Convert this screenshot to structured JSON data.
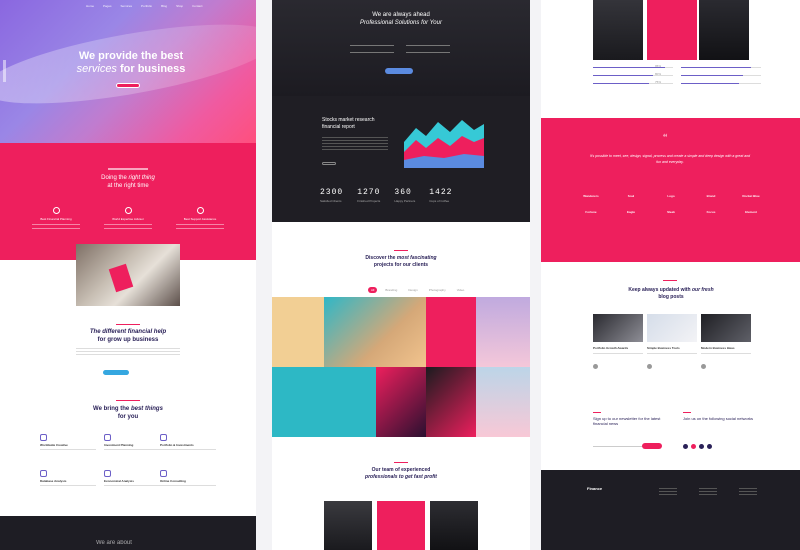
{
  "col1": {
    "hero": {
      "logo": "",
      "nav": [
        "Home",
        "Pages",
        "Services",
        "Portfolio",
        "Blog",
        "Shop",
        "Contact"
      ],
      "title_a": "We provide the best",
      "title_em": "services",
      "title_b": " for business"
    },
    "pink": {
      "title_a": "Doing the",
      "title_em": "right thing",
      "title_b": "at the right time",
      "features": [
        {
          "label": "Best Financial Planning",
          "icon": "chart-icon"
        },
        {
          "label": "World Expertise Advisor",
          "icon": "globe-icon"
        },
        {
          "label": "Best Support Assistance",
          "icon": "support-icon"
        }
      ]
    },
    "about": {
      "title_em": "The different financial help",
      "title_b": "for grow up business"
    },
    "services": {
      "title_a": "We bring the",
      "title_em": "best things",
      "title_b": "for you",
      "items": [
        {
          "label": "Worldwide Creative",
          "icon": "globe-icon"
        },
        {
          "label": "Investment Planning",
          "icon": "plan-icon"
        },
        {
          "label": "Portfolio & Investments",
          "icon": "briefcase-icon"
        },
        {
          "label": "Database Analysis",
          "icon": "database-icon"
        },
        {
          "label": "Economical Analysis",
          "icon": "analysis-icon"
        },
        {
          "label": "Online Consulting",
          "icon": "rocket-icon"
        }
      ]
    },
    "footer_text": "We are about"
  },
  "col2": {
    "hero": {
      "title_a": "We are always ahead",
      "title_em": "Professional Solutions for Your"
    },
    "report": {
      "title": "Stocks market research financial report"
    },
    "stats": [
      {
        "n": "2300",
        "l": "Satisfied Clients"
      },
      {
        "n": "1270",
        "l": "Finished Projects"
      },
      {
        "n": "360",
        "l": "Happy Partners"
      },
      {
        "n": "1422",
        "l": "Cups of Coffee"
      }
    ],
    "discover": {
      "title_a": "Discover the",
      "title_em": "most fascinating",
      "title_b": "projects for our clients",
      "filters": [
        "All",
        "Branding",
        "Design",
        "Photography",
        "Video"
      ]
    },
    "team": {
      "title_a": "Our team of experienced",
      "title_em": "professionals to get fast profit"
    }
  },
  "col3": {
    "team_bars": [
      {
        "value": "95%"
      },
      {
        "value": "80%"
      },
      {
        "value": "75%"
      }
    ],
    "testimonial": {
      "mark": "“",
      "text": "It's possible to meet, see, design, signal, process and create a simple and deep design with a great and fun and everyday."
    },
    "logos": [
      "Wanderers",
      "Soul",
      "Logo",
      "Brand",
      "Rocket Blue",
      "Fortune",
      "Eagle",
      "Sleek",
      "Focus",
      "Element"
    ],
    "blog": {
      "title_a": "Keep always updated with",
      "title_em": "our fresh",
      "title_b": "blog posts",
      "posts": [
        {
          "title": "Portfolio Growth Awards"
        },
        {
          "title": "Simple Business Tools"
        },
        {
          "title": "Modern Business Ideas"
        }
      ]
    },
    "signup": {
      "left": "Sign up to our newsletter for the latest financial news",
      "right": "Join us on the following social networks"
    },
    "footer_logo": "Finance"
  },
  "colors": {
    "accent": "#ee1f5d",
    "navy": "#2a2158",
    "dark": "#1e1d24"
  }
}
